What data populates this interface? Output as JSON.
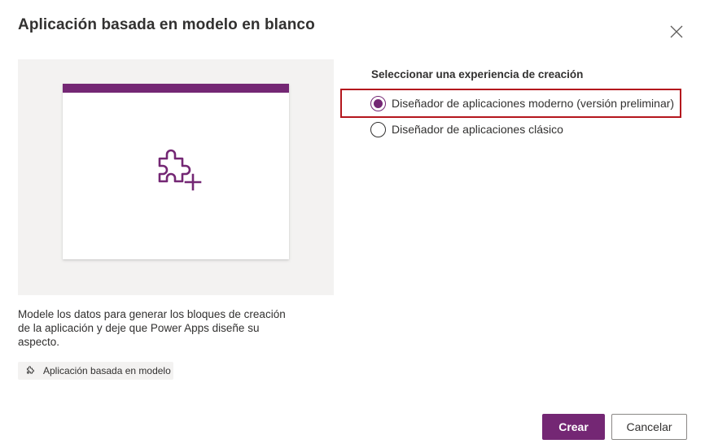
{
  "dialog": {
    "title": "Aplicación basada en modelo en blanco",
    "close_icon": "close-icon"
  },
  "preview": {
    "icon": "puzzle-add-icon",
    "accent_color": "#742774"
  },
  "description": "Modele los datos para generar los bloques de creación de la aplicación y deje que Power Apps diseñe su aspecto.",
  "tag": {
    "icon": "puzzle-icon",
    "label": "Aplicación basada en modelo"
  },
  "experience": {
    "label": "Seleccionar una experiencia de creación",
    "options": [
      {
        "label": "Diseñador de aplicaciones moderno (versión preliminar)",
        "selected": true
      },
      {
        "label": "Diseñador de aplicaciones clásico",
        "selected": false
      }
    ],
    "highlight_color": "#b4161d"
  },
  "buttons": {
    "create": "Crear",
    "cancel": "Cancelar"
  }
}
